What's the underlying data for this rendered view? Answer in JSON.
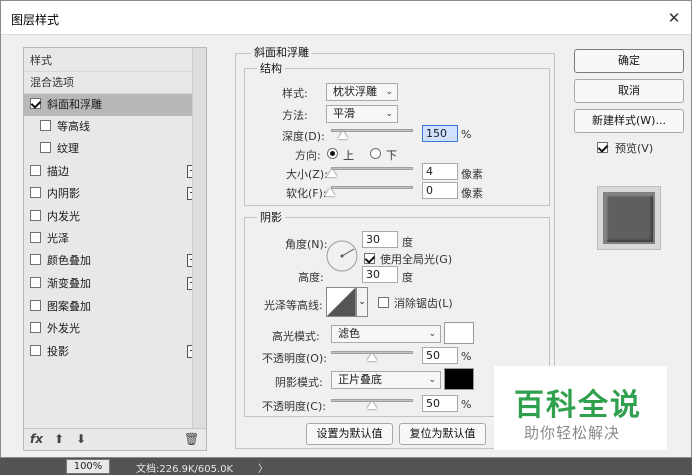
{
  "window": {
    "title": "图层样式",
    "close_glyph": "✕"
  },
  "style_list": {
    "header_styles": "样式",
    "header_blend": "混合选项",
    "items": [
      {
        "label": "斜面和浮雕",
        "checked": true,
        "selected": true,
        "plus": false
      },
      {
        "label": "等高线",
        "checked": false,
        "sub": true
      },
      {
        "label": "纹理",
        "checked": false,
        "sub": true
      },
      {
        "label": "描边",
        "checked": false,
        "plus": true
      },
      {
        "label": "内阴影",
        "checked": false,
        "plus": true
      },
      {
        "label": "内发光",
        "checked": false
      },
      {
        "label": "光泽",
        "checked": false
      },
      {
        "label": "颜色叠加",
        "checked": false,
        "plus": true
      },
      {
        "label": "渐变叠加",
        "checked": false,
        "plus": true
      },
      {
        "label": "图案叠加",
        "checked": false
      },
      {
        "label": "外发光",
        "checked": false
      },
      {
        "label": "投影",
        "checked": false,
        "plus": true
      }
    ],
    "fx_label": "fx",
    "up_glyph": "⬆",
    "down_glyph": "⬇",
    "trash_glyph": "🗑"
  },
  "bevel": {
    "group_title": "斜面和浮雕",
    "structure_title": "结构",
    "style_label": "样式:",
    "style_value": "枕状浮雕",
    "method_label": "方法:",
    "method_value": "平滑",
    "depth_label": "深度(D):",
    "depth_value": "150",
    "depth_unit": "%",
    "direction_label": "方向:",
    "dir_up": "上",
    "dir_down": "下",
    "size_label": "大小(Z):",
    "size_value": "4",
    "size_unit": "像素",
    "soften_label": "软化(F):",
    "soften_value": "0",
    "soften_unit": "像素"
  },
  "shading": {
    "title": "阴影",
    "angle_label": "角度(N):",
    "angle_value": "30",
    "angle_unit": "度",
    "global_light_label": "使用全局光(G)",
    "altitude_label": "高度:",
    "altitude_value": "30",
    "altitude_unit": "度",
    "gloss_label": "光泽等高线:",
    "antialias_label": "消除锯齿(L)",
    "highlight_label": "高光模式:",
    "highlight_value": "滤色",
    "highlight_color": "#ffffff",
    "highlight_opacity_label": "不透明度(O):",
    "highlight_opacity_value": "50",
    "shadow_label": "阴影模式:",
    "shadow_value": "正片叠底",
    "shadow_color": "#000000",
    "shadow_opacity_label": "不透明度(C):",
    "shadow_opacity_value": "50",
    "percent": "%"
  },
  "bottom_buttons": {
    "set_default": "设置为默认值",
    "reset_default": "复位为默认值"
  },
  "right": {
    "ok": "确定",
    "cancel": "取消",
    "new_style": "新建样式(W)...",
    "preview_label": "预览(V)",
    "preview_checked": true
  },
  "watermark": {
    "big": "百科全说",
    "small": "助你轻松解决"
  },
  "statusbar": {
    "zoom": "100%",
    "doc": "文档:226.9K/605.0K",
    "arrow": "〉"
  },
  "colors": {
    "accent_green": "#2fa04d",
    "dialog_bg": "#f0f0f0"
  },
  "icons": [
    "close-icon",
    "checkbox-icon",
    "plus-icon",
    "fx-icon",
    "arrow-up-icon",
    "arrow-down-icon",
    "trash-icon",
    "chevron-down-icon",
    "radio-icon"
  ]
}
